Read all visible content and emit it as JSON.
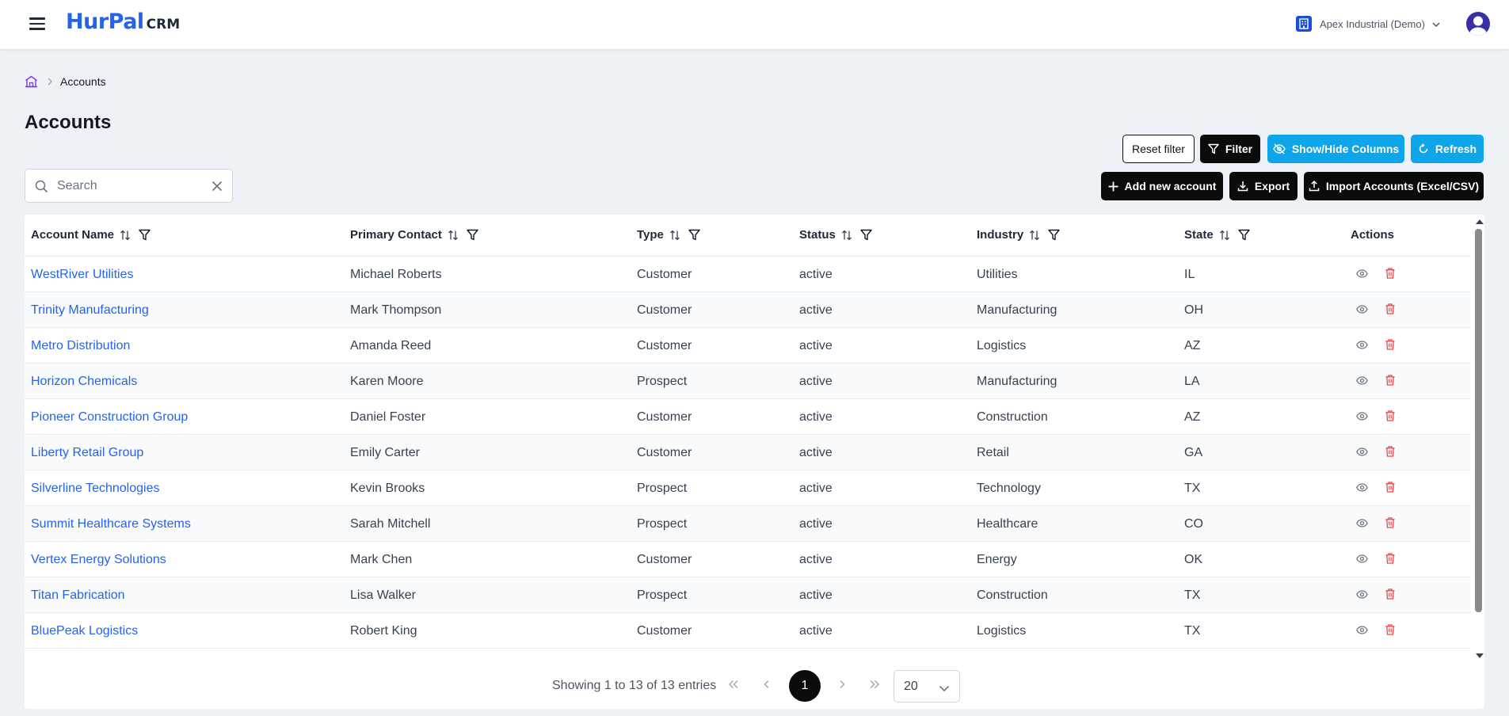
{
  "app": {
    "brand": "HurPal",
    "product": "CRM",
    "organization": "Apex Industrial (Demo)"
  },
  "breadcrumb": {
    "current": "Accounts"
  },
  "page": {
    "title": "Accounts"
  },
  "toolbar": {
    "reset_filter": "Reset filter",
    "filter": "Filter",
    "show_hide_columns": "Show/Hide Columns",
    "refresh": "Refresh",
    "add_new_account": "Add new account",
    "export": "Export",
    "import_accounts": "Import Accounts (Excel/CSV)"
  },
  "search": {
    "placeholder": "Search",
    "value": ""
  },
  "table": {
    "columns": [
      "Account Name",
      "Primary Contact",
      "Type",
      "Status",
      "Industry",
      "State",
      "Actions"
    ],
    "rows": [
      {
        "name": "WestRiver Utilities",
        "contact": "Michael Roberts",
        "type": "Customer",
        "status": "active",
        "industry": "Utilities",
        "state": "IL"
      },
      {
        "name": "Trinity Manufacturing",
        "contact": "Mark Thompson",
        "type": "Customer",
        "status": "active",
        "industry": "Manufacturing",
        "state": "OH"
      },
      {
        "name": "Metro Distribution",
        "contact": "Amanda Reed",
        "type": "Customer",
        "status": "active",
        "industry": "Logistics",
        "state": "AZ"
      },
      {
        "name": "Horizon Chemicals",
        "contact": "Karen Moore",
        "type": "Prospect",
        "status": "active",
        "industry": "Manufacturing",
        "state": "LA"
      },
      {
        "name": "Pioneer Construction Group",
        "contact": "Daniel Foster",
        "type": "Customer",
        "status": "active",
        "industry": "Construction",
        "state": "AZ"
      },
      {
        "name": "Liberty Retail Group",
        "contact": "Emily Carter",
        "type": "Customer",
        "status": "active",
        "industry": "Retail",
        "state": "GA"
      },
      {
        "name": "Silverline Technologies",
        "contact": "Kevin Brooks",
        "type": "Prospect",
        "status": "active",
        "industry": "Technology",
        "state": "TX"
      },
      {
        "name": "Summit Healthcare Systems",
        "contact": "Sarah Mitchell",
        "type": "Prospect",
        "status": "active",
        "industry": "Healthcare",
        "state": "CO"
      },
      {
        "name": "Vertex Energy Solutions",
        "contact": "Mark Chen",
        "type": "Customer",
        "status": "active",
        "industry": "Energy",
        "state": "OK"
      },
      {
        "name": "Titan Fabrication",
        "contact": "Lisa Walker",
        "type": "Prospect",
        "status": "active",
        "industry": "Construction",
        "state": "TX"
      },
      {
        "name": "BluePeak Logistics",
        "contact": "Robert King",
        "type": "Customer",
        "status": "active",
        "industry": "Logistics",
        "state": "TX"
      }
    ]
  },
  "pagination": {
    "summary": "Showing 1 to 13 of 13 entries",
    "current_page": "1",
    "per_page": "20"
  },
  "colors": {
    "brand": "#2563eb",
    "link": "#2563eb",
    "dark_button": "#0b0b0c",
    "sky_button": "#0ea5e9",
    "delete_icon": "#ef4444",
    "background": "#eef2f7"
  },
  "icons": {
    "menu": "hamburger-icon",
    "org": "building-icon",
    "home": "home-icon",
    "sort": "sort-icon",
    "filter": "filter-icon",
    "view": "eye-icon",
    "delete": "trash-icon"
  }
}
